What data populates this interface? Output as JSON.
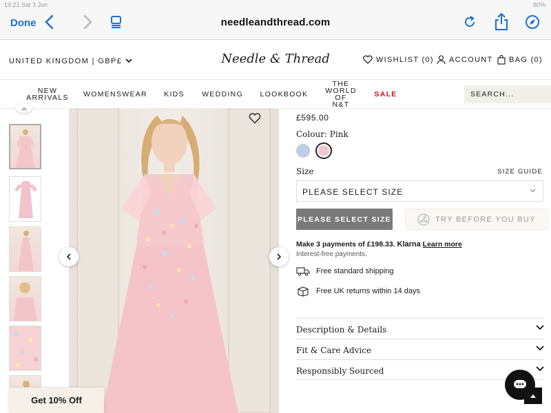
{
  "browser": {
    "status_left": "19:21  Sat 3 Jun",
    "status_right": "80%",
    "done_label": "Done",
    "url": "needleandthread.com"
  },
  "header": {
    "locale": "UNITED KINGDOM | GBP£",
    "logo": "Needle & Thread",
    "wishlist": "WISHLIST (0)",
    "account": "ACCOUNT",
    "bag": "BAG (0)"
  },
  "nav": {
    "items": [
      {
        "line1": "NEW",
        "line2": "ARRIVALS"
      },
      {
        "line1": "WOMENSWEAR"
      },
      {
        "line1": "KIDS"
      },
      {
        "line1": "WEDDING"
      },
      {
        "line1": "LOOKBOOK"
      },
      {
        "line1": "THE",
        "line2": "WORLD",
        "line3": "OF",
        "line4": "N&T"
      },
      {
        "line1": "SALE"
      }
    ],
    "search_placeholder": "SEARCH..."
  },
  "product": {
    "price": "£595.00",
    "colour_label": "Colour: Pink",
    "swatches": [
      {
        "name": "Blue",
        "color": "#b9cfe9"
      },
      {
        "name": "Pink",
        "color": "#f0c8d0",
        "selected": true
      }
    ],
    "size_label": "Size",
    "size_guide": "SIZE GUIDE",
    "size_select": "PLEASE SELECT SIZE",
    "select_size_button": "PLEASE SELECT SIZE",
    "try_button": "TRY BEFORE YOU BUY",
    "klarna_text": "Make 3 payments of £198.33.",
    "klarna_brand": "Klarna",
    "klarna_link": "Learn more",
    "interest_free": "Interest-free payments.",
    "shipping": "Free standard shipping",
    "returns": "Free UK returns within 14 days",
    "accordion": [
      "Description & Details",
      "Fit & Care Advice",
      "Responsibly Sourced"
    ]
  },
  "widgets": {
    "promo": "Get 10% Off"
  },
  "colors": {
    "accent_blue": "#1a6fd1",
    "sale_red": "#d20f1a",
    "dress_pink": "#f3c9cc"
  }
}
